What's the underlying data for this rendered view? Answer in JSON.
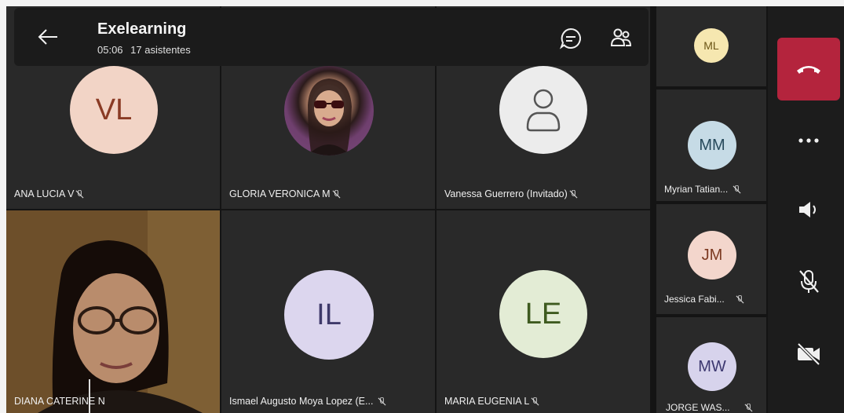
{
  "meeting": {
    "title": "Exelearning",
    "duration": "05:06",
    "attendees": "17 asistentes"
  },
  "grid": [
    {
      "name": "ANA LUCIA V",
      "initials": "VL",
      "avatar_bg": "#f2d4c6",
      "avatar_fg": "#8a3b25",
      "muted": true
    },
    {
      "name": "GLORIA VERONICA M",
      "initials": "",
      "avatar_bg": "#6f3f6e",
      "muted": true,
      "photo": true
    },
    {
      "name": "Vanessa Guerrero (Invitado)",
      "initials": "",
      "avatar_bg": "#ececec",
      "muted": true,
      "generic": true
    },
    {
      "name": "DIANA CATERINE N",
      "initials": "",
      "muted": false,
      "video": true
    },
    {
      "name": "Ismael Augusto Moya Lopez (E...",
      "initials": "IL",
      "avatar_bg": "#dcd6ee",
      "avatar_fg": "#3f3a6a",
      "muted": true
    },
    {
      "name": "MARIA EUGENIA L",
      "initials": "LE",
      "avatar_bg": "#e3ecd5",
      "avatar_fg": "#3e5a1f",
      "muted": true
    }
  ],
  "sidebar": [
    {
      "name": "",
      "initials": "ML",
      "avatar_bg": "#f6e7b0",
      "avatar_fg": "#6b5516",
      "muted": false
    },
    {
      "name": "Myrian Tatian...",
      "initials": "MM",
      "avatar_bg": "#c6dbe6",
      "avatar_fg": "#274a5c",
      "muted": true
    },
    {
      "name": "Jessica Fabi...",
      "initials": "JM",
      "avatar_bg": "#f3d6cc",
      "avatar_fg": "#7c3a22",
      "muted": true
    },
    {
      "name": "JORGE WAS...",
      "initials": "MW",
      "avatar_bg": "#d7d3ec",
      "avatar_fg": "#3d3870",
      "muted": true
    }
  ],
  "colors": {
    "end_call": "#b4243d",
    "tile_bg": "#292929",
    "stage_bg": "#141414"
  },
  "icons": {
    "back": "arrow-left-icon",
    "chat": "chat-icon",
    "participants": "participants-icon",
    "end_call": "phone-hangup-icon",
    "more": "more-options-icon",
    "speaker": "speaker-icon",
    "mic": "mic-off-icon",
    "camera": "camera-off-icon"
  }
}
